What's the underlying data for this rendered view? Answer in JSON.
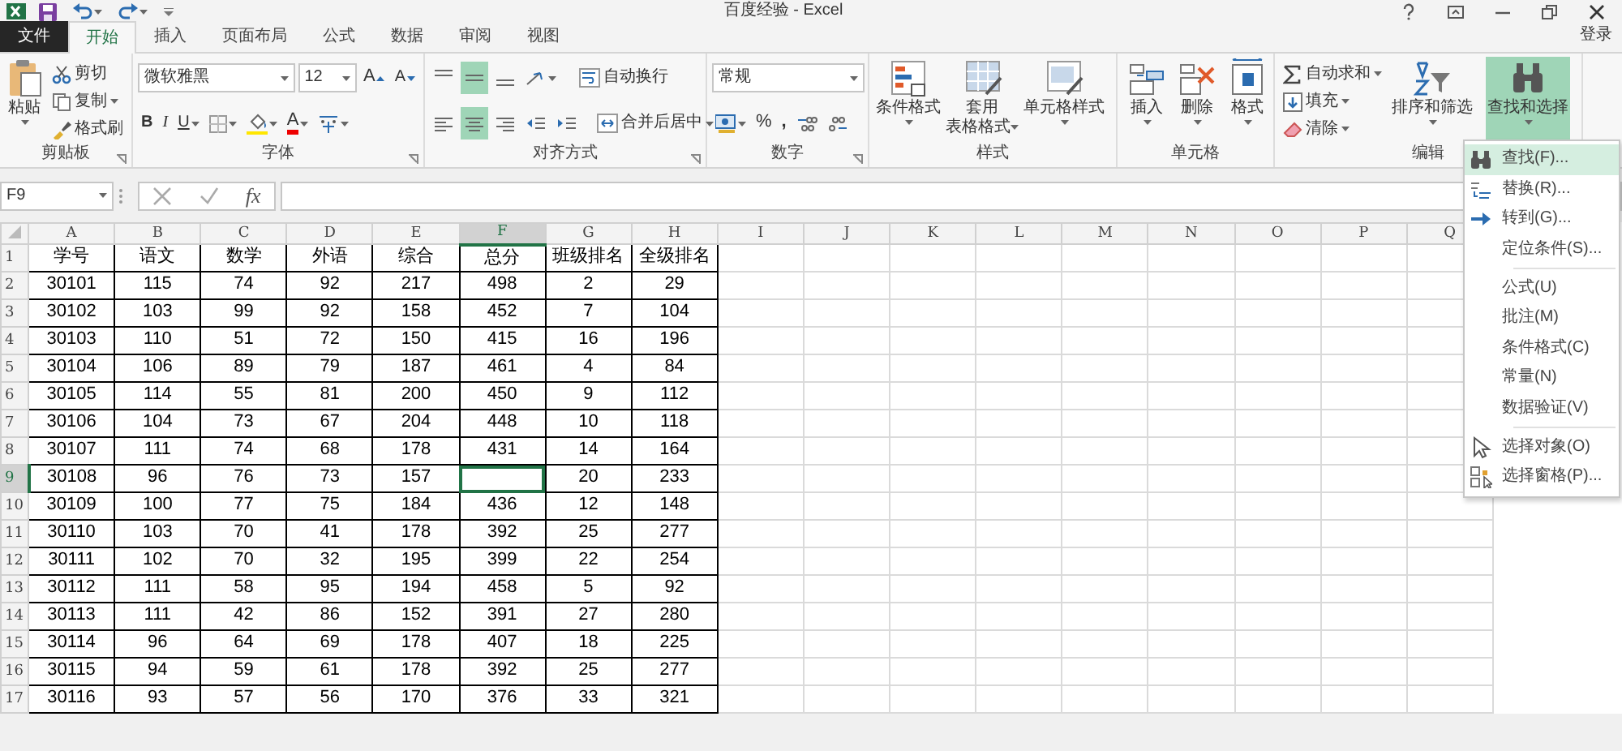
{
  "title_bar": {
    "title": "百度经验 - Excel",
    "sign_in": "登录"
  },
  "tabs": [
    {
      "label": "文件",
      "kind": "file",
      "selected": false
    },
    {
      "label": "开始",
      "kind": "tab",
      "selected": true
    },
    {
      "label": "插入",
      "kind": "tab",
      "selected": false
    },
    {
      "label": "页面布局",
      "kind": "tab",
      "selected": false
    },
    {
      "label": "公式",
      "kind": "tab",
      "selected": false
    },
    {
      "label": "数据",
      "kind": "tab",
      "selected": false
    },
    {
      "label": "审阅",
      "kind": "tab",
      "selected": false
    },
    {
      "label": "视图",
      "kind": "tab",
      "selected": false
    }
  ],
  "ribbon": [
    {
      "kind": "clipboard",
      "label": "剪贴板",
      "paste": "粘贴",
      "items": [
        "剪切",
        "复制",
        "格式刷"
      ]
    },
    {
      "kind": "font",
      "label": "字体",
      "font_name": "微软雅黑",
      "font_size": "12",
      "grow": "A",
      "shrink": "A",
      "styles": [
        "B",
        "I",
        "U"
      ],
      "font_color": "A"
    },
    {
      "kind": "alignment",
      "label": "对齐方式",
      "vertical": [
        {
          "selected": false
        },
        {
          "selected": true
        },
        {
          "selected": false
        }
      ],
      "horizontal": [
        {
          "selected": false
        },
        {
          "selected": true
        },
        {
          "selected": false
        }
      ],
      "wrap": "自动换行",
      "merge": "合并后居中"
    },
    {
      "kind": "number",
      "label": "数字",
      "format": "常规",
      "percent": "%",
      "comma": ","
    },
    {
      "kind": "styles",
      "label": "样式",
      "buttons": [
        {
          "lines": [
            "条件格式"
          ]
        },
        {
          "lines": [
            "套用",
            "表格格式"
          ]
        },
        {
          "lines": [
            "单元格样式"
          ]
        }
      ]
    },
    {
      "kind": "cells",
      "label": "单元格",
      "buttons": [
        "插入",
        "删除",
        "格式"
      ]
    },
    {
      "kind": "editing",
      "label": "编辑",
      "items": [
        "自动求和",
        "填充",
        "清除"
      ],
      "sort": "排序和筛选",
      "find": {
        "label": "查找和选择",
        "pressed": true
      }
    }
  ],
  "formula_bar": {
    "name_box": "F9",
    "fx": "fx"
  },
  "sheet": {
    "columns": [
      {
        "label": "A",
        "selected": false
      },
      {
        "label": "B",
        "selected": false
      },
      {
        "label": "C",
        "selected": false
      },
      {
        "label": "D",
        "selected": false
      },
      {
        "label": "E",
        "selected": false
      },
      {
        "label": "F",
        "selected": true
      },
      {
        "label": "G",
        "selected": false
      },
      {
        "label": "H",
        "selected": false
      },
      {
        "label": "I",
        "selected": false
      },
      {
        "label": "J",
        "selected": false
      },
      {
        "label": "K",
        "selected": false
      },
      {
        "label": "L",
        "selected": false
      },
      {
        "label": "M",
        "selected": false
      },
      {
        "label": "N",
        "selected": false
      },
      {
        "label": "O",
        "selected": false
      },
      {
        "label": "P",
        "selected": false
      },
      {
        "label": "Q",
        "selected": false
      }
    ],
    "rows": [
      {
        "label": "1",
        "selected": false,
        "cells": [
          "学号",
          "语文",
          "数学",
          "外语",
          "综合",
          "总分",
          "班级排名",
          "全级排名"
        ]
      },
      {
        "label": "2",
        "selected": false,
        "cells": [
          "30101",
          "115",
          "74",
          "92",
          "217",
          "498",
          "2",
          "29"
        ]
      },
      {
        "label": "3",
        "selected": false,
        "cells": [
          "30102",
          "103",
          "99",
          "92",
          "158",
          "452",
          "7",
          "104"
        ]
      },
      {
        "label": "4",
        "selected": false,
        "cells": [
          "30103",
          "110",
          "51",
          "72",
          "150",
          "415",
          "16",
          "196"
        ]
      },
      {
        "label": "5",
        "selected": false,
        "cells": [
          "30104",
          "106",
          "89",
          "79",
          "187",
          "461",
          "4",
          "84"
        ]
      },
      {
        "label": "6",
        "selected": false,
        "cells": [
          "30105",
          "114",
          "55",
          "81",
          "200",
          "450",
          "9",
          "112"
        ]
      },
      {
        "label": "7",
        "selected": false,
        "cells": [
          "30106",
          "104",
          "73",
          "67",
          "204",
          "448",
          "10",
          "118"
        ]
      },
      {
        "label": "8",
        "selected": false,
        "cells": [
          "30107",
          "111",
          "74",
          "68",
          "178",
          "431",
          "14",
          "164"
        ]
      },
      {
        "label": "9",
        "selected": true,
        "cells": [
          "30108",
          "96",
          "76",
          "73",
          "157",
          null,
          "20",
          "233"
        ]
      },
      {
        "label": "10",
        "selected": false,
        "cells": [
          "30109",
          "100",
          "77",
          "75",
          "184",
          "436",
          "12",
          "148"
        ]
      },
      {
        "label": "11",
        "selected": false,
        "cells": [
          "30110",
          "103",
          "70",
          "41",
          "178",
          "392",
          "25",
          "277"
        ]
      },
      {
        "label": "12",
        "selected": false,
        "cells": [
          "30111",
          "102",
          "70",
          "32",
          "195",
          "399",
          "22",
          "254"
        ]
      },
      {
        "label": "13",
        "selected": false,
        "cells": [
          "30112",
          "111",
          "58",
          "95",
          "194",
          "458",
          "5",
          "92"
        ]
      },
      {
        "label": "14",
        "selected": false,
        "cells": [
          "30113",
          "111",
          "42",
          "86",
          "152",
          "391",
          "27",
          "280"
        ]
      },
      {
        "label": "15",
        "selected": false,
        "cells": [
          "30114",
          "96",
          "64",
          "69",
          "178",
          "407",
          "18",
          "225"
        ]
      },
      {
        "label": "16",
        "selected": false,
        "cells": [
          "30115",
          "94",
          "59",
          "61",
          "178",
          "392",
          "25",
          "277"
        ]
      },
      {
        "label": "17",
        "selected": false,
        "cells": [
          "30116",
          "93",
          "57",
          "56",
          "170",
          "376",
          "33",
          "321"
        ]
      }
    ]
  },
  "find_menu": {
    "groups": [
      [
        {
          "label": "查找(F)...",
          "kind": "binoculars",
          "selected": true
        },
        {
          "label": "替换(R)...",
          "kind": "replace",
          "selected": false
        },
        {
          "label": "转到(G)...",
          "kind": "arrow",
          "selected": false
        },
        {
          "label": "定位条件(S)...",
          "kind": "plain",
          "selected": false
        }
      ],
      [
        {
          "label": "公式(U)",
          "kind": "plain",
          "selected": false
        },
        {
          "label": "批注(M)",
          "kind": "plain",
          "selected": false
        },
        {
          "label": "条件格式(C)",
          "kind": "plain",
          "selected": false
        },
        {
          "label": "常量(N)",
          "kind": "plain",
          "selected": false
        },
        {
          "label": "数据验证(V)",
          "kind": "plain",
          "selected": false
        }
      ],
      [
        {
          "label": "选择对象(O)",
          "kind": "pointer",
          "selected": false
        },
        {
          "label": "选择窗格(P)...",
          "kind": "pane",
          "selected": false
        }
      ]
    ]
  }
}
